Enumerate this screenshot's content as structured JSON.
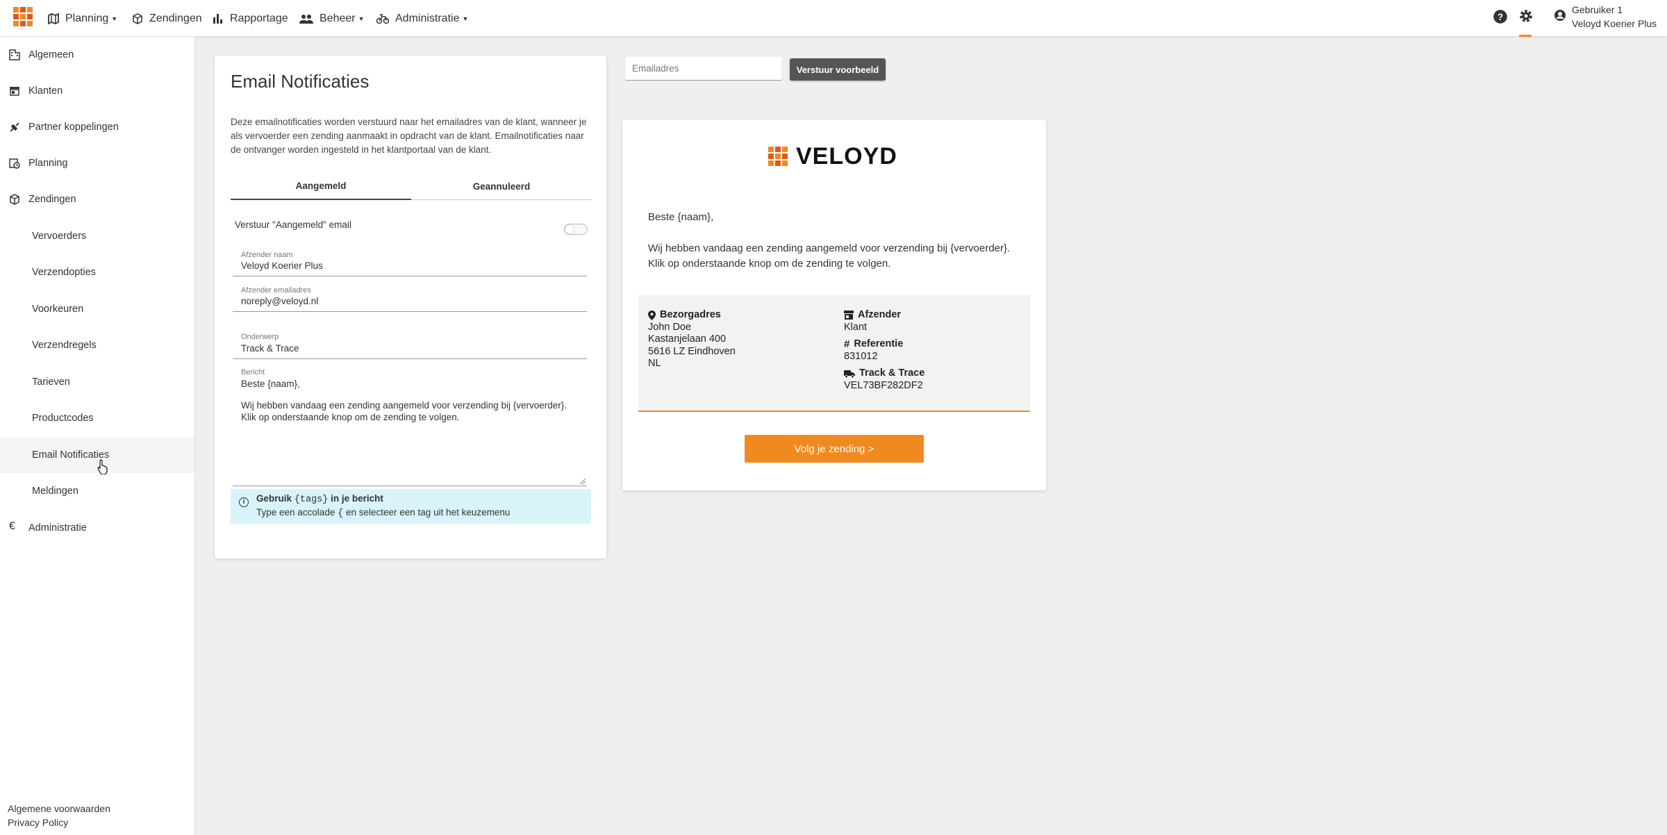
{
  "topbar": {
    "nav": [
      {
        "label": "Planning",
        "icon": "map-icon",
        "dropdown": true
      },
      {
        "label": "Zendingen",
        "icon": "box-icon",
        "dropdown": false
      },
      {
        "label": "Rapportage",
        "icon": "bar-chart-icon",
        "dropdown": false
      },
      {
        "label": "Beheer",
        "icon": "people-icon",
        "dropdown": true
      },
      {
        "label": "Administratie",
        "icon": "bike-icon",
        "dropdown": true
      }
    ],
    "user": {
      "name": "Gebruiker 1",
      "company": "Veloyd Koerier Plus"
    }
  },
  "sidebar": {
    "items": [
      {
        "label": "Algemeen",
        "icon": "building-icon"
      },
      {
        "label": "Klanten",
        "icon": "store-icon"
      },
      {
        "label": "Partner koppelingen",
        "icon": "plug-icon"
      },
      {
        "label": "Planning",
        "icon": "calendar-clock-icon"
      },
      {
        "label": "Zendingen",
        "icon": "box-icon"
      },
      {
        "label": "Vervoerders"
      },
      {
        "label": "Verzendopties"
      },
      {
        "label": "Voorkeuren"
      },
      {
        "label": "Verzendregels"
      },
      {
        "label": "Tarieven"
      },
      {
        "label": "Productcodes"
      },
      {
        "label": "Email Notificaties",
        "active": true
      },
      {
        "label": "Meldingen"
      },
      {
        "label": "Administratie",
        "icon": "euro-icon"
      }
    ],
    "footer": {
      "terms": "Algemene voorwaarden",
      "privacy": "Privacy Policy"
    }
  },
  "settings": {
    "title": "Email Notificaties",
    "description": "Deze emailnotificaties worden verstuurd naar het emailadres van de klant, wanneer je als vervoerder een zending aanmaakt in opdracht van de klant. Emailnotificaties naar de ontvanger worden ingesteld in het klantportaal van de klant.",
    "tabs": [
      "Aangemeld",
      "Geannuleerd"
    ],
    "toggle_label": "Verstuur \"Aangemeld\" email",
    "toggle_on": false,
    "fields": {
      "sender_name_label": "Afzender naam",
      "sender_name": "Veloyd Koerier Plus",
      "sender_email_label": "Afzender emailadres",
      "sender_email": "noreply@veloyd.nl",
      "subject_label": "Onderwerp",
      "subject": "Track & Trace",
      "message_label": "Bericht",
      "message_line1": "Beste {naam},",
      "message_line2": "Wij hebben vandaag een zending aangemeld voor verzending bij {vervoerder}. Klik op onderstaande knop om de zending te volgen."
    },
    "info": {
      "title_pre": "Gebruik ",
      "title_code": "{tags}",
      "title_post": " in je bericht",
      "body_pre": "Type een accolade ",
      "body_code": "{",
      "body_post": " en selecteer een tag uit het keuzemenu"
    }
  },
  "preview_controls": {
    "email_placeholder": "Emailadres",
    "send_label": "Verstuur voorbeeld"
  },
  "preview": {
    "brand": "VELOYD",
    "greeting": "Beste {naam},",
    "body_line1": "Wij hebben vandaag een zending aangemeld voor verzending bij {vervoerder}.",
    "body_line2": "Klik op onderstaande knop om de zending te volgen.",
    "address_title": "Bezorgadres",
    "address": [
      "John Doe",
      "Kastanjelaan 400",
      "5616 LZ Eindhoven",
      "NL"
    ],
    "sender_title": "Afzender",
    "sender": "Klant",
    "reference_title": "Referentie",
    "reference": "831012",
    "tracking_title": "Track & Trace",
    "tracking": "VEL73BF282DF2",
    "button": "Volg je zending >"
  },
  "colors": {
    "accent": "#f08a1e",
    "logo_dark": "#e2571e",
    "info_bg": "#d9f3fb"
  }
}
